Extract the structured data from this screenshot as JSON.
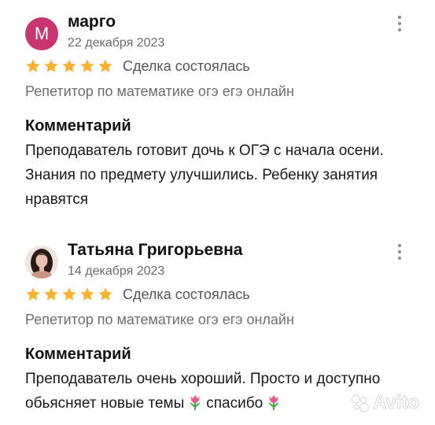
{
  "reviews": [
    {
      "avatar_letter": "М",
      "avatar_color": "#c7366f",
      "name": "марго",
      "date": "22 декабря 2023",
      "rating": 5,
      "deal_status": "Сделка состоялась",
      "service": "Репетитор по математике огэ егэ онлайн",
      "comment_title": "Комментарий",
      "comment": "Преподаватель готовит дочь к ОГЭ с начала осени. Знания по предмету улучшились. Ребенку занятия нравятся"
    },
    {
      "avatar_image": "profile photo of a woman with dark hair",
      "name": "Татьяна Григорьевна",
      "date": "14 декабря 2023",
      "rating": 5,
      "deal_status": "Сделка состоялась",
      "service": "Репетитор по математике огэ егэ онлайн",
      "comment_title": "Комментарий",
      "comment_part1": "Преподаватель очень хороший. Просто и доступно обьясняет новые темы",
      "comment_part2": "спасибо",
      "emoji": "tulip-icon"
    }
  ],
  "star_color": "#f5b335",
  "watermark": "Avito"
}
